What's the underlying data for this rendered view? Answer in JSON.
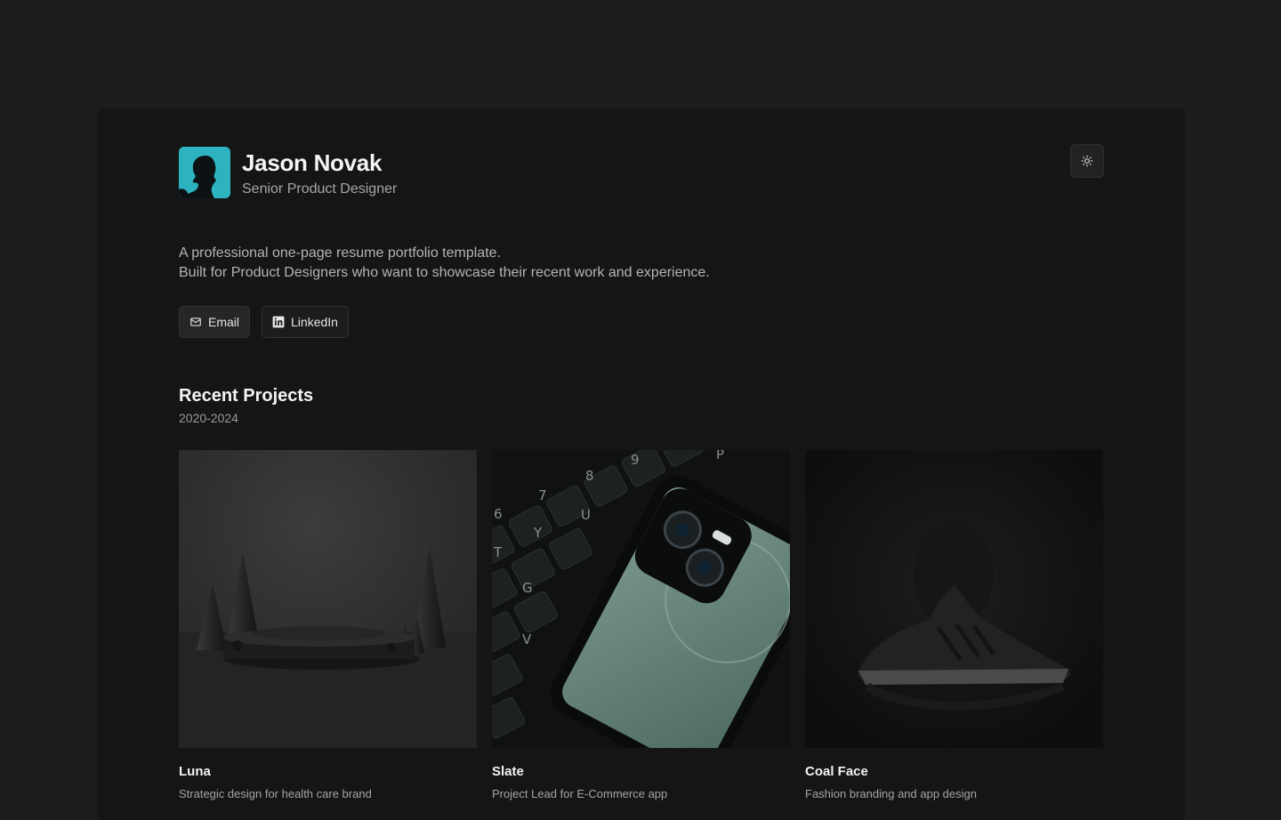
{
  "profile": {
    "name": "Jason Novak",
    "role": "Senior Product Designer",
    "avatar_icon": "person-silhouette-icon",
    "avatar_color": "#2cb3bf"
  },
  "theme_toggle": {
    "icon": "sun-icon"
  },
  "intro": {
    "line1": "A professional one-page resume portfolio template.",
    "line2": "Built for Product Designers who want to showcase their recent work and experience."
  },
  "links": [
    {
      "label": "Email",
      "icon": "mail-icon"
    },
    {
      "label": "LinkedIn",
      "icon": "linkedin-icon"
    }
  ],
  "projects_section": {
    "title": "Recent Projects",
    "years": "2020-2024",
    "items": [
      {
        "title": "Luna",
        "description": "Strategic design for health care brand"
      },
      {
        "title": "Slate",
        "description": "Project Lead for E-Commerce app"
      },
      {
        "title": "Coal Face",
        "description": "Fashion branding and app design"
      }
    ]
  },
  "keyboard_keys": [
    "8",
    "9",
    "P",
    "7",
    "6",
    "Y",
    "U",
    "T",
    "G",
    "V"
  ]
}
